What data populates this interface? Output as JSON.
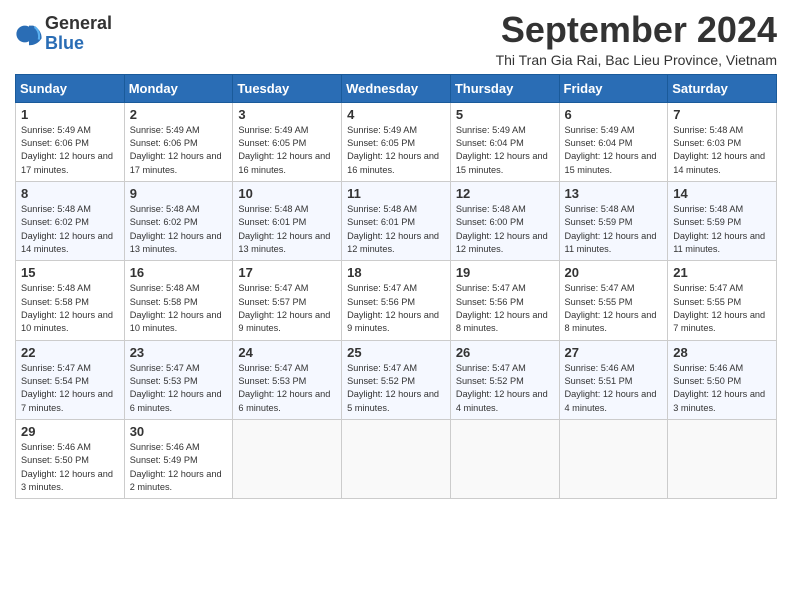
{
  "logo": {
    "general": "General",
    "blue": "Blue"
  },
  "header": {
    "month_title": "September 2024",
    "subtitle": "Thi Tran Gia Rai, Bac Lieu Province, Vietnam"
  },
  "weekdays": [
    "Sunday",
    "Monday",
    "Tuesday",
    "Wednesday",
    "Thursday",
    "Friday",
    "Saturday"
  ],
  "weeks": [
    [
      {
        "day": "1",
        "sunrise": "5:49 AM",
        "sunset": "6:06 PM",
        "daylight": "12 hours and 17 minutes."
      },
      {
        "day": "2",
        "sunrise": "5:49 AM",
        "sunset": "6:06 PM",
        "daylight": "12 hours and 17 minutes."
      },
      {
        "day": "3",
        "sunrise": "5:49 AM",
        "sunset": "6:05 PM",
        "daylight": "12 hours and 16 minutes."
      },
      {
        "day": "4",
        "sunrise": "5:49 AM",
        "sunset": "6:05 PM",
        "daylight": "12 hours and 16 minutes."
      },
      {
        "day": "5",
        "sunrise": "5:49 AM",
        "sunset": "6:04 PM",
        "daylight": "12 hours and 15 minutes."
      },
      {
        "day": "6",
        "sunrise": "5:49 AM",
        "sunset": "6:04 PM",
        "daylight": "12 hours and 15 minutes."
      },
      {
        "day": "7",
        "sunrise": "5:48 AM",
        "sunset": "6:03 PM",
        "daylight": "12 hours and 14 minutes."
      }
    ],
    [
      {
        "day": "8",
        "sunrise": "5:48 AM",
        "sunset": "6:02 PM",
        "daylight": "12 hours and 14 minutes."
      },
      {
        "day": "9",
        "sunrise": "5:48 AM",
        "sunset": "6:02 PM",
        "daylight": "12 hours and 13 minutes."
      },
      {
        "day": "10",
        "sunrise": "5:48 AM",
        "sunset": "6:01 PM",
        "daylight": "12 hours and 13 minutes."
      },
      {
        "day": "11",
        "sunrise": "5:48 AM",
        "sunset": "6:01 PM",
        "daylight": "12 hours and 12 minutes."
      },
      {
        "day": "12",
        "sunrise": "5:48 AM",
        "sunset": "6:00 PM",
        "daylight": "12 hours and 12 minutes."
      },
      {
        "day": "13",
        "sunrise": "5:48 AM",
        "sunset": "5:59 PM",
        "daylight": "12 hours and 11 minutes."
      },
      {
        "day": "14",
        "sunrise": "5:48 AM",
        "sunset": "5:59 PM",
        "daylight": "12 hours and 11 minutes."
      }
    ],
    [
      {
        "day": "15",
        "sunrise": "5:48 AM",
        "sunset": "5:58 PM",
        "daylight": "12 hours and 10 minutes."
      },
      {
        "day": "16",
        "sunrise": "5:48 AM",
        "sunset": "5:58 PM",
        "daylight": "12 hours and 10 minutes."
      },
      {
        "day": "17",
        "sunrise": "5:47 AM",
        "sunset": "5:57 PM",
        "daylight": "12 hours and 9 minutes."
      },
      {
        "day": "18",
        "sunrise": "5:47 AM",
        "sunset": "5:56 PM",
        "daylight": "12 hours and 9 minutes."
      },
      {
        "day": "19",
        "sunrise": "5:47 AM",
        "sunset": "5:56 PM",
        "daylight": "12 hours and 8 minutes."
      },
      {
        "day": "20",
        "sunrise": "5:47 AM",
        "sunset": "5:55 PM",
        "daylight": "12 hours and 8 minutes."
      },
      {
        "day": "21",
        "sunrise": "5:47 AM",
        "sunset": "5:55 PM",
        "daylight": "12 hours and 7 minutes."
      }
    ],
    [
      {
        "day": "22",
        "sunrise": "5:47 AM",
        "sunset": "5:54 PM",
        "daylight": "12 hours and 7 minutes."
      },
      {
        "day": "23",
        "sunrise": "5:47 AM",
        "sunset": "5:53 PM",
        "daylight": "12 hours and 6 minutes."
      },
      {
        "day": "24",
        "sunrise": "5:47 AM",
        "sunset": "5:53 PM",
        "daylight": "12 hours and 6 minutes."
      },
      {
        "day": "25",
        "sunrise": "5:47 AM",
        "sunset": "5:52 PM",
        "daylight": "12 hours and 5 minutes."
      },
      {
        "day": "26",
        "sunrise": "5:47 AM",
        "sunset": "5:52 PM",
        "daylight": "12 hours and 4 minutes."
      },
      {
        "day": "27",
        "sunrise": "5:46 AM",
        "sunset": "5:51 PM",
        "daylight": "12 hours and 4 minutes."
      },
      {
        "day": "28",
        "sunrise": "5:46 AM",
        "sunset": "5:50 PM",
        "daylight": "12 hours and 3 minutes."
      }
    ],
    [
      {
        "day": "29",
        "sunrise": "5:46 AM",
        "sunset": "5:50 PM",
        "daylight": "12 hours and 3 minutes."
      },
      {
        "day": "30",
        "sunrise": "5:46 AM",
        "sunset": "5:49 PM",
        "daylight": "12 hours and 2 minutes."
      },
      null,
      null,
      null,
      null,
      null
    ]
  ]
}
